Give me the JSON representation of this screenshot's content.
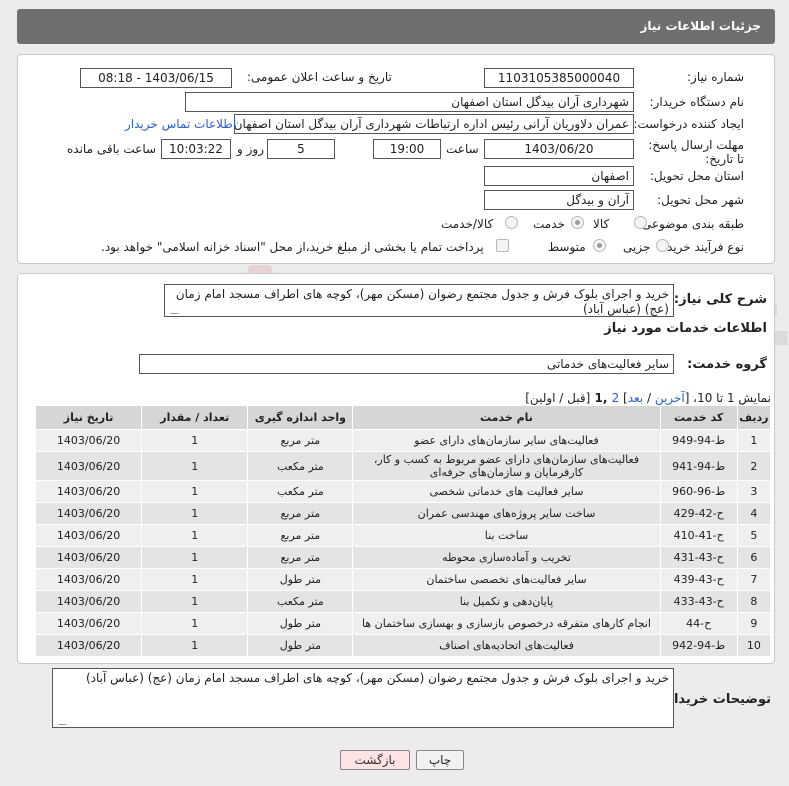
{
  "header": {
    "title": "جزئیات اطلاعات نیاز"
  },
  "form": {
    "need_number_label": "شماره نیاز:",
    "need_number": "1103105385000040",
    "announce_label": "تاریخ و ساعت اعلان عمومی:",
    "announce_value": "1403/06/15 - 08:18",
    "buyer_org_label": "نام دستگاه خریدار:",
    "buyer_org": "شهرداری آران بیدگل استان اصفهان",
    "requester_label": "ایجاد کننده درخواست:",
    "requester": "عمران دلاوریان آرانی رئیس اداره ارتباطات شهرداری آران بیدگل استان اصفهان",
    "contact_link": "اطلاعات تماس خریدار",
    "deadline_label": "مهلت ارسال پاسخ: تا تاریخ:",
    "deadline_date": "1403/06/20",
    "hour_label": "ساعت",
    "deadline_time": "19:00",
    "days_value": "5",
    "days_label": "روز و",
    "remaining_time": "10:03:22",
    "remaining_label": "ساعت باقی مانده",
    "province_label": "استان محل تحویل:",
    "province": "اصفهان",
    "city_label": "شهر محل تحویل:",
    "city": "آران و بیدگل",
    "category_label": "طبقه بندی موضوعی:",
    "category_options": [
      "کالا",
      "خدمت",
      "کالا/خدمت"
    ],
    "process_label": "نوع فرآیند خرید :",
    "process_options": [
      "جزیی",
      "متوسط"
    ],
    "payment_note": "پرداخت تمام یا بخشی از مبلغ خرید،از محل \"اسناد خزانه اسلامی\" خواهد بود."
  },
  "summary": {
    "label": "شرح کلی نیاز:",
    "text": "خرید و اجرای بلوک فرش و جدول مجتمع رضوان (مسکن مهر)، کوچه های اطراف مسجد امام زمان (عج) (عباس آباد)",
    "services_heading": "اطلاعات خدمات مورد نیاز",
    "group_label": "گروه خدمت:",
    "group_value": "سایر فعالیت‌های خدماتی"
  },
  "pager": {
    "prefix": "نمایش 1 تا 10، [",
    "last": "آخرین",
    "sep1": " / ",
    "next": "بعد",
    "mid": "] ",
    "page2": "2",
    "page1": " ,1 ",
    "suffix": "[قبل / اولین]"
  },
  "table": {
    "headers": [
      "ردیف",
      "کد خدمت",
      "نام خدمت",
      "واحد اندازه گیری",
      "تعداد / مقدار",
      "تاریخ نیاز"
    ],
    "rows": [
      [
        "1",
        "ط-94-949",
        "فعالیت‌های سایر سازمان‌های دارای عضو",
        "متر مربع",
        "1",
        "1403/06/20"
      ],
      [
        "2",
        "ط-94-941",
        "فعالیت‌های سازمان‌های دارای عضو مربوط به کسب و کار، کارفرمایان و سازمان‌های حرفه‌ای",
        "متر مکعب",
        "1",
        "1403/06/20"
      ],
      [
        "3",
        "ط-96-960",
        "سایر فعالیت های خدماتی شخصی",
        "متر مکعب",
        "1",
        "1403/06/20"
      ],
      [
        "4",
        "ح-42-429",
        "ساخت سایر پروژه‌های مهندسی عمران",
        "متر مربع",
        "1",
        "1403/06/20"
      ],
      [
        "5",
        "ح-41-410",
        "ساخت بنا",
        "متر مربع",
        "1",
        "1403/06/20"
      ],
      [
        "6",
        "ح-43-431",
        "تخریب و آماده‌سازی محوطه",
        "متر مربع",
        "1",
        "1403/06/20"
      ],
      [
        "7",
        "ح-43-439",
        "سایر فعالیت‌های تخصصی ساختمان",
        "متر طول",
        "1",
        "1403/06/20"
      ],
      [
        "8",
        "ح-43-433",
        "پایان‌دهی و تکمیل بنا",
        "متر مکعب",
        "1",
        "1403/06/20"
      ],
      [
        "9",
        "ح-44",
        "انجام کارهای متفرقه درخصوص بازسازی و بهسازی ساختمان ها",
        "متر طول",
        "1",
        "1403/06/20"
      ],
      [
        "10",
        "ط-94-942",
        "فعالیت‌های اتحادیه‌های اصناف",
        "متر طول",
        "1",
        "1403/06/20"
      ]
    ]
  },
  "buyer_notes": {
    "label": "توضیحات خریدار:",
    "text": "خرید و اجرای بلوک فرش و جدول مجتمع رضوان (مسکن مهر)، کوچه های اطراف مسجد امام زمان (عج) (عباس آباد)"
  },
  "buttons": {
    "print": "چاپ",
    "back": "بازگشت"
  },
  "watermark": "AriaTender.neT"
}
